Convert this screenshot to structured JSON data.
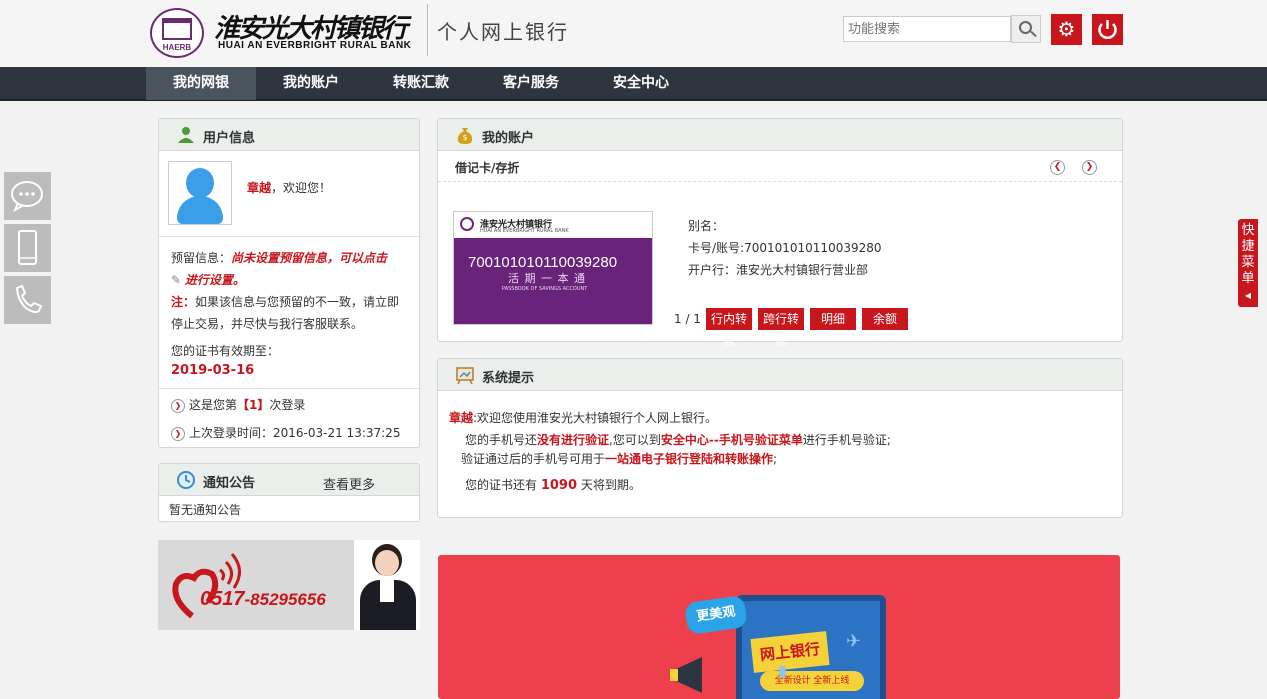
{
  "header": {
    "logo_seal_text": "HAERB",
    "logo_cn": "淮安光大村镇银行",
    "logo_en": "HUAI AN EVERBRIGHT RURAL BANK",
    "site_title": "个人网上银行",
    "search_placeholder": "功能搜索"
  },
  "nav": {
    "items": [
      "我的网银",
      "我的账户",
      "转账汇款",
      "客户服务",
      "安全中心"
    ],
    "active": "我的网银"
  },
  "user_info": {
    "title": "用户信息",
    "name": "章越",
    "welcome": "，欢迎您！",
    "reserved_label": "预留信息：",
    "reserved_warn": "尚未设置预留信息，可以点击",
    "reserved_link": "进行设置。",
    "note_label": "注：",
    "note_text": "如果该信息与您预留的不一致，请立即停止交易，并尽快与我行客服联系。",
    "cert_label": "您的证书有效期至：",
    "cert_date": "2019-03-16",
    "login_count_pre": "这是您第",
    "login_count": "【1】",
    "login_count_post": "次登录",
    "last_login": "上次登录时间：2016-03-21 13:37:25"
  },
  "notice": {
    "title": "通知公告",
    "more": "查看更多",
    "empty": "暂无通知公告"
  },
  "hotline": {
    "phone_prefix": "0517",
    "phone_rest": "-85295656"
  },
  "account": {
    "title": "我的账户",
    "tab": "借记卡/存折",
    "card_bank": "淮安光大村镇银行",
    "card_bank_en": "HUAI AN EVERBRIGHT RURAL BANK",
    "card_number": "700101010110039280",
    "card_subtitle": "活 期 一 本 通",
    "card_passbook": "PASSBOOK OF SAVINGS ACCOUNT",
    "alias_label": "别名：",
    "card_no_line": "卡号/账号:700101010110039280",
    "branch_line": "开户行：淮安光大村镇银行营业部",
    "pager": "1 / 1",
    "buttons": [
      "行内转账",
      "跨行转账",
      "明细",
      "余额"
    ]
  },
  "system": {
    "title": "系统提示",
    "name": "章越",
    "line1": ":欢迎您使用淮安光大村镇银行个人网上银行。",
    "line2_pre": "您的手机号还",
    "line2_red1": "没有进行验证",
    "line2_mid": ",您可以到",
    "line2_red2": "安全中心--手机号验证菜单",
    "line2_post": "进行手机号验证;",
    "line3_pre": "验证通过后的手机号可用于",
    "line3_red": "一站通电子银行登陆和转账操作",
    "line3_post": ";",
    "line4_pre": "您的证书还有",
    "line4_days": "1090",
    "line4_post": "天将到期。"
  },
  "banner": {
    "tag": "更美观",
    "title": "网上银行",
    "sub": "全新设计 全新上线"
  },
  "quick_menu": "快捷菜单",
  "colors": {
    "accent": "#c8161d",
    "nav": "#2d3640",
    "brand_purple": "#6b2c6f"
  }
}
